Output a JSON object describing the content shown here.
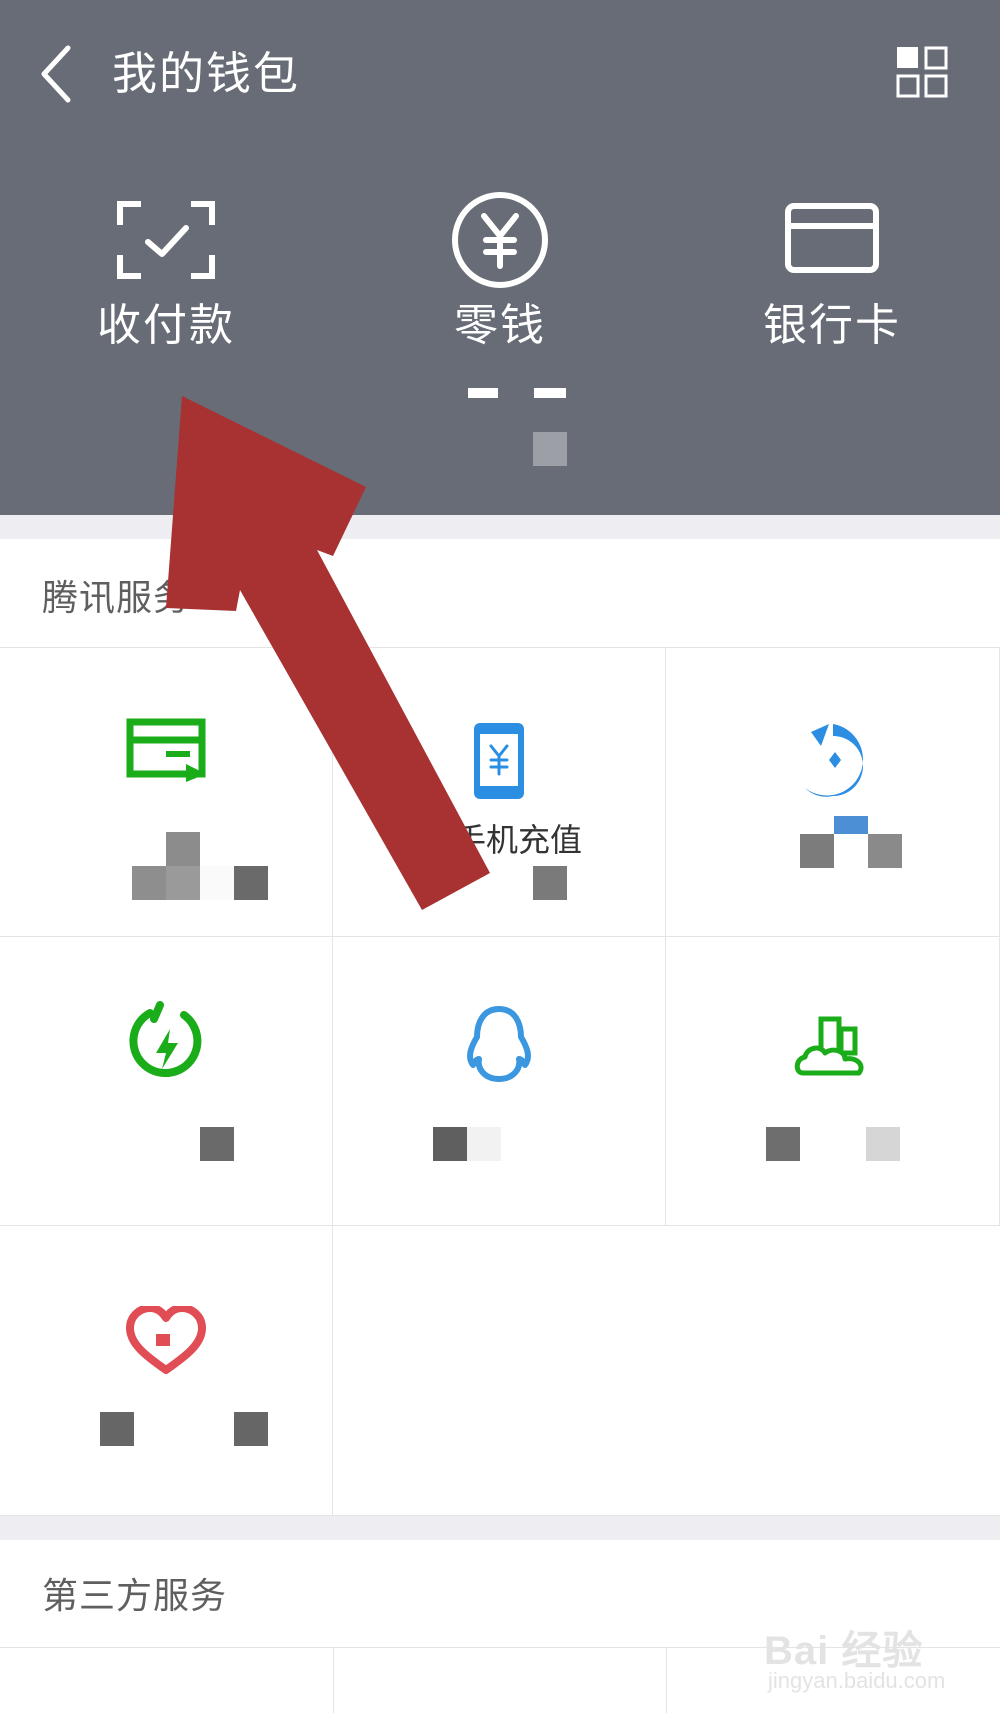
{
  "header": {
    "title": "我的钱包",
    "background": "#676c76"
  },
  "top_actions": [
    {
      "label": "收付款",
      "icon": "scan-check-icon"
    },
    {
      "label": "零钱",
      "icon": "yuan-coin-icon"
    },
    {
      "label": "银行卡",
      "icon": "bank-card-icon"
    }
  ],
  "sections": {
    "tencent": "腾讯服务",
    "third_party": "第三方服务"
  },
  "services": [
    {
      "label": "信用卡还款",
      "icon": "credit-card-repay-icon",
      "color": "#1aad19"
    },
    {
      "label": "手机充值",
      "icon": "phone-recharge-icon",
      "color": "#2b8ee3"
    },
    {
      "label": "理财通",
      "icon": "wealth-icon",
      "color": "#2b8ee3"
    },
    {
      "label": "生活缴费",
      "icon": "bolt-icon",
      "color": "#1aad19"
    },
    {
      "label": "Q币充值",
      "icon": "qq-penguin-icon",
      "color": "#2b8ee3"
    },
    {
      "label": "城市服务",
      "icon": "city-service-icon",
      "color": "#1aad19"
    },
    {
      "label": "腾讯公益",
      "icon": "heart-icon",
      "color": "#e64340"
    }
  ],
  "annotation": {
    "arrow_color": "#a83131"
  },
  "watermark": {
    "logo": "Bai 经验",
    "url": "jingyan.baidu.com"
  }
}
